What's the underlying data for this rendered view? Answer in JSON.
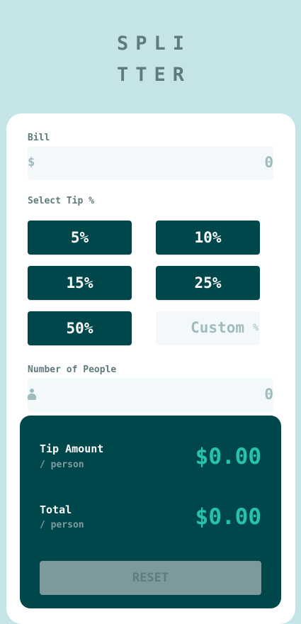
{
  "logo": {
    "line1": "SPLI",
    "line2": "TTER"
  },
  "bill": {
    "label": "Bill",
    "prefix": "$",
    "value": "0"
  },
  "tip": {
    "label": "Select Tip %",
    "options": [
      "5%",
      "10%",
      "15%",
      "25%",
      "50%"
    ],
    "custom_placeholder": "Custom",
    "custom_suffix": "%"
  },
  "people": {
    "label": "Number of People",
    "icon": "person-icon",
    "value": "0"
  },
  "results": {
    "tip_title": "Tip Amount",
    "tip_sub": "/ person",
    "tip_value": "$0.00",
    "total_title": "Total",
    "total_sub": "/ person",
    "total_value": "$0.00",
    "reset_label": "RESET"
  },
  "colors": {
    "background": "#c5e4e7",
    "primary": "#00474b",
    "accent": "#26c2ae",
    "muted": "#5e7a7d",
    "input_bg": "#f3f9fa"
  }
}
